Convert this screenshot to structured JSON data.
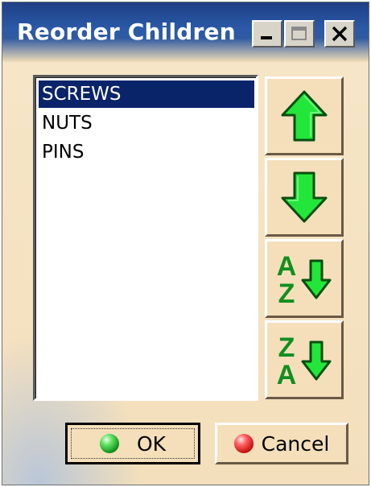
{
  "window": {
    "title": "Reorder Children"
  },
  "titlebar": {
    "minimize_icon": "minimize-icon",
    "maximize_icon": "maximize-icon",
    "close_icon": "close-icon"
  },
  "list": {
    "items": [
      {
        "label": "SCREWS",
        "selected": true
      },
      {
        "label": "NUTS",
        "selected": false
      },
      {
        "label": "PINS",
        "selected": false
      }
    ]
  },
  "side_buttons": {
    "move_up_icon": "arrow-up-icon",
    "move_down_icon": "arrow-down-icon",
    "sort_az_icon": "sort-az-icon",
    "sort_za_icon": "sort-za-icon",
    "sort_az_letters": [
      "A",
      "Z"
    ],
    "sort_za_letters": [
      "Z",
      "A"
    ]
  },
  "buttons": {
    "ok_label": "OK",
    "cancel_label": "Cancel"
  },
  "colors": {
    "title_bar": "#2b5aa7",
    "selection": "#0a246a",
    "arrow_green": "#22e63a",
    "letter_green": "#0f8f1f",
    "dialog_bg": "#f4dfba"
  }
}
